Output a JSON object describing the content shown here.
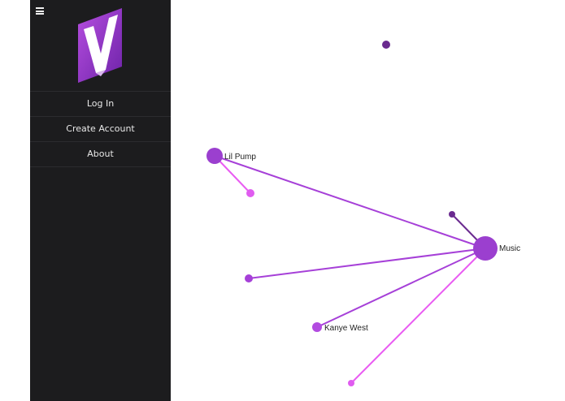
{
  "sidebar": {
    "menu_icon": "hamburger-menu-icon",
    "logo_icon": "purple-v-logo-icon",
    "nav": {
      "login": "Log In",
      "create_account": "Create Account",
      "about": "About"
    }
  },
  "graph": {
    "labels": {
      "music": "Music",
      "lil_pump": "Lil Pump",
      "kanye_west": "Kanye West"
    },
    "colors": {
      "hub": "#9b3fcf",
      "dark_purple": "#6a2a8f",
      "violet": "#a640d8",
      "magenta": "#e05cf0",
      "link_violet": "#a640d8",
      "link_magenta": "#e95cf2"
    }
  }
}
